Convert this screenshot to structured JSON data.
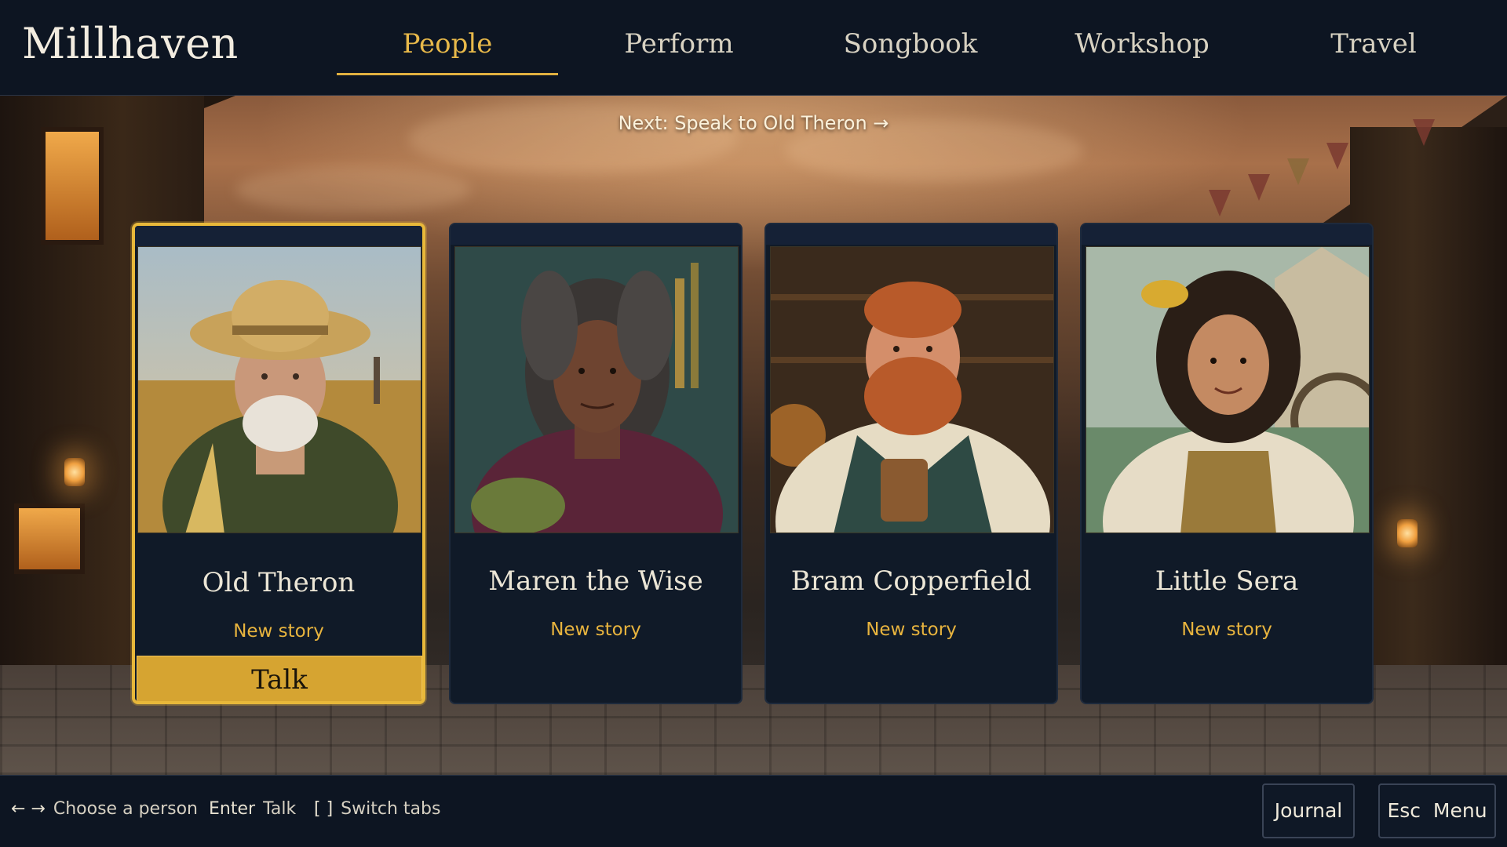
{
  "app": {
    "title": "Millhaven"
  },
  "nav": {
    "tabs": [
      {
        "label": "People",
        "active": true
      },
      {
        "label": "Perform",
        "active": false
      },
      {
        "label": "Songbook",
        "active": false
      },
      {
        "label": "Workshop",
        "active": false
      },
      {
        "label": "Travel",
        "active": false
      }
    ]
  },
  "objective": {
    "text": "Next: Speak to Old Theron →"
  },
  "people": [
    {
      "name": "Old Theron",
      "status": "New story",
      "selected": true,
      "action": "Talk"
    },
    {
      "name": "Maren the Wise",
      "status": "New story",
      "selected": false
    },
    {
      "name": "Bram Copperfield",
      "status": "New story",
      "selected": false
    },
    {
      "name": "Little Sera",
      "status": "New story",
      "selected": false
    }
  ],
  "footer": {
    "hints": [
      {
        "key": "← →",
        "label": "Choose a person"
      },
      {
        "key": "Enter",
        "label": "Talk"
      },
      {
        "key": "[ ]",
        "label": "Switch tabs"
      }
    ],
    "journal_label": "Journal",
    "menu_key": "Esc",
    "menu_label": "Menu"
  },
  "colors": {
    "accent": "#e8b83a",
    "panel": "#101a28",
    "bar": "#0d1522"
  }
}
